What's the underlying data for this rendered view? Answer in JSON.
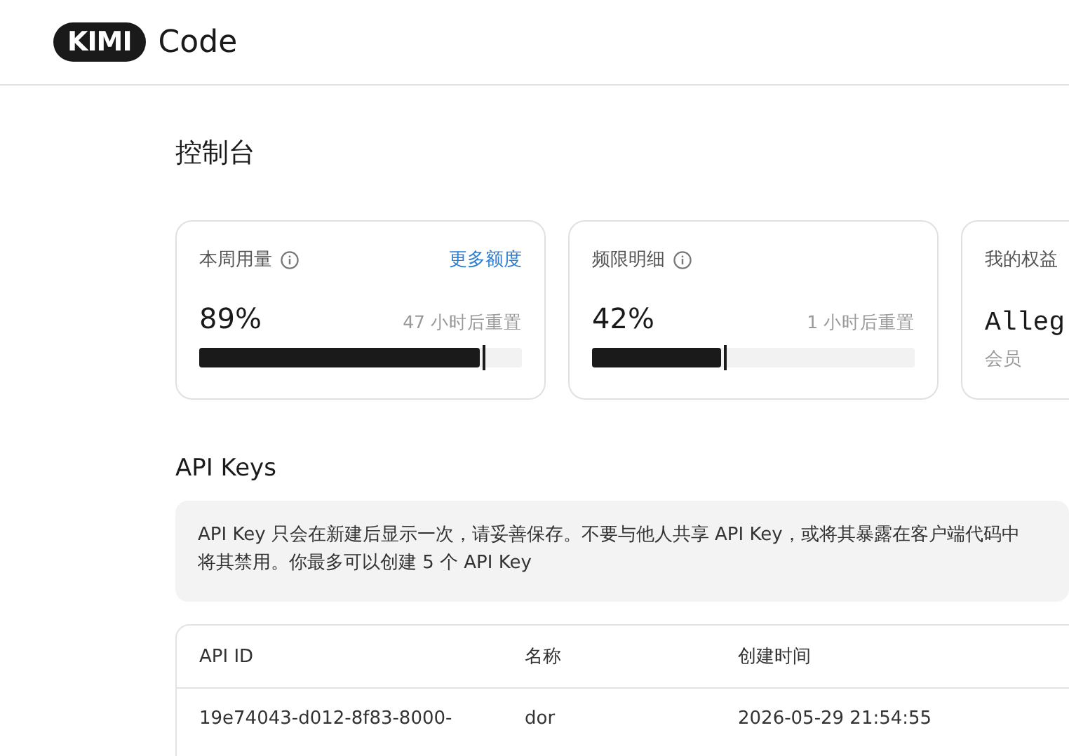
{
  "header": {
    "logo_badge": "KIMI",
    "logo_text": "Code"
  },
  "page_title": "控制台",
  "usage_cards": [
    {
      "kind": "meter",
      "label": "本周用量",
      "info": true,
      "link": "更多额度",
      "percent": "89%",
      "reset": "47 小时后重置",
      "level": 0.89
    },
    {
      "kind": "meter",
      "label": "频限明细",
      "info": true,
      "percent": "42%",
      "reset": "1 小时后重置",
      "level": 0.42
    },
    {
      "kind": "plan",
      "label": "我的权益",
      "info": false,
      "plan": "Alleg",
      "tier": "会员"
    }
  ],
  "api_keys": {
    "title": "API Keys",
    "notice_lines": [
      "API Key 只会在新建后显示一次，请妥善保存。不要与他人共享 API Key，或将其暴露在客户端代码中",
      "将其禁用。你最多可以创建 5 个 API Key"
    ],
    "table": {
      "columns": [
        "API ID",
        "名称",
        "创建时间"
      ],
      "rows": [
        [
          "19e74043-d012-8f83-8000-",
          "dor",
          "2026-05-29 21:54:55"
        ]
      ]
    }
  }
}
